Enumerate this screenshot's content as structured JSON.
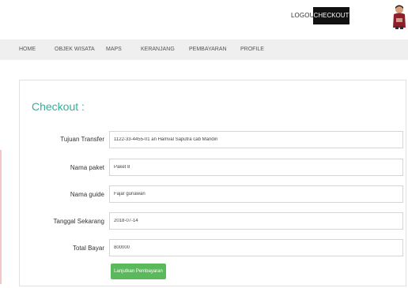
{
  "header": {
    "logout_label": "LOGOUT",
    "checkout_label": "CHECKOUT",
    "avatar_icon": "user-avatar-icon"
  },
  "nav": {
    "items": [
      {
        "label": "HOME"
      },
      {
        "label": "OBJEK WISATA"
      },
      {
        "label": "MAPS"
      },
      {
        "label": "KERANJANG"
      },
      {
        "label": "PEMBAYARAN"
      },
      {
        "label": "PROFILE"
      }
    ]
  },
  "checkout": {
    "title": "Checkout :",
    "fields": [
      {
        "label": "Tujuan Transfer",
        "value": "1122-33-4455-01 an Hamval Saputra cab Mandiri"
      },
      {
        "label": "Nama paket",
        "value": "Paket 8"
      },
      {
        "label": "Nama guide",
        "value": "Fajar gunawan"
      },
      {
        "label": "Tanggal Sekarang",
        "value": "2018-07-14"
      },
      {
        "label": "Total Bayar",
        "value": "800000"
      }
    ],
    "submit_label": "Lanjutkan Pembayaran"
  },
  "colors": {
    "accent": "#2fb39a",
    "button_green": "#5cb85c",
    "checkout_black": "#111111"
  }
}
